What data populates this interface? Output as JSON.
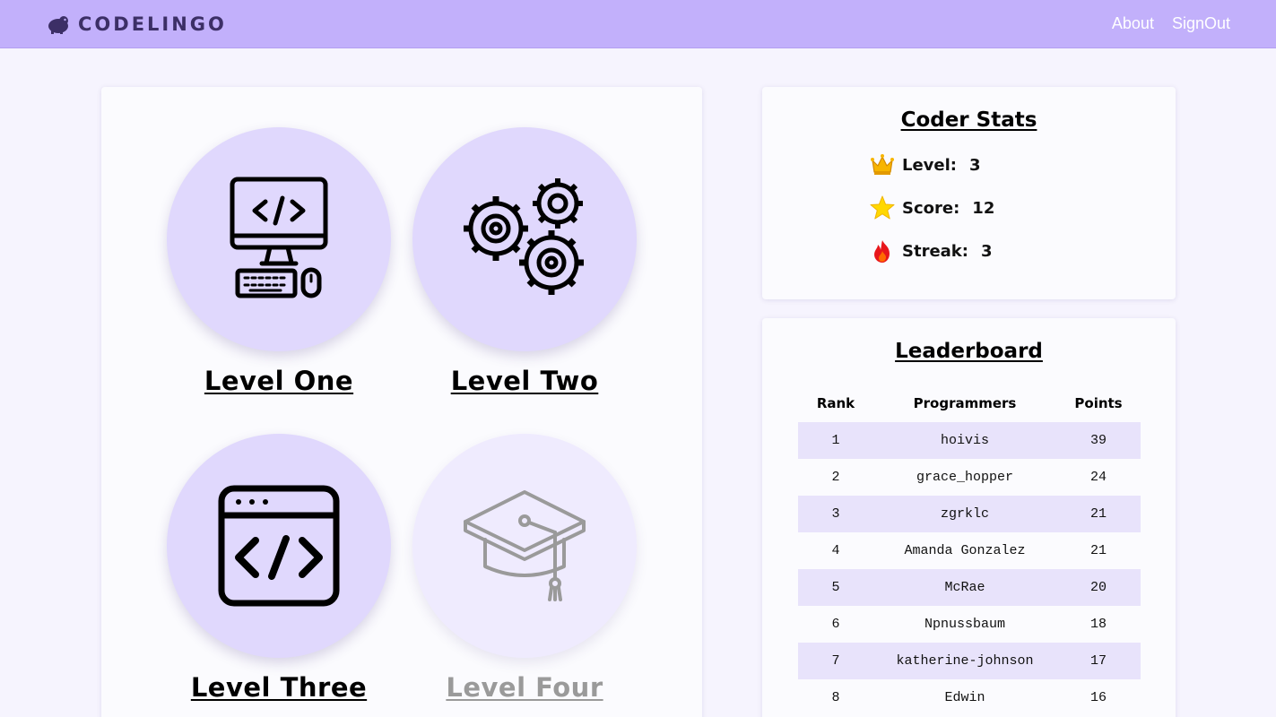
{
  "nav": {
    "brand": "CODELINGO",
    "links": [
      "About",
      "SignOut"
    ]
  },
  "levels": [
    {
      "label": "Level One",
      "icon": "computer-code-icon",
      "locked": false
    },
    {
      "label": "Level Two",
      "icon": "gears-icon",
      "locked": false
    },
    {
      "label": "Level Three",
      "icon": "code-window-icon",
      "locked": false
    },
    {
      "label": "Level Four",
      "icon": "graduation-cap-icon",
      "locked": true
    }
  ],
  "stats": {
    "title": "Coder Stats",
    "rows": [
      {
        "label": "Level:",
        "value": "3",
        "icon": "crown-icon"
      },
      {
        "label": "Score:",
        "value": "12",
        "icon": "star-icon"
      },
      {
        "label": "Streak:",
        "value": "3",
        "icon": "flame-icon"
      }
    ]
  },
  "leaderboard": {
    "title": "Leaderboard",
    "columns": [
      "Rank",
      "Programmers",
      "Points"
    ],
    "rows": [
      [
        "1",
        "hoivis",
        "39"
      ],
      [
        "2",
        "grace_hopper",
        "24"
      ],
      [
        "3",
        "zgrklc",
        "21"
      ],
      [
        "4",
        "Amanda Gonzalez",
        "21"
      ],
      [
        "5",
        "McRae",
        "20"
      ],
      [
        "6",
        "Npnussbaum",
        "18"
      ],
      [
        "7",
        "katherine-johnson",
        "17"
      ],
      [
        "8",
        "Edwin",
        "16"
      ]
    ]
  },
  "colors": {
    "navbar": "#c2b0fb",
    "circle": "#e0d8fd",
    "circle_locked": "#efebfe",
    "row_highlight": "#e8e3fb",
    "locked_text": "#9a9a9a"
  }
}
